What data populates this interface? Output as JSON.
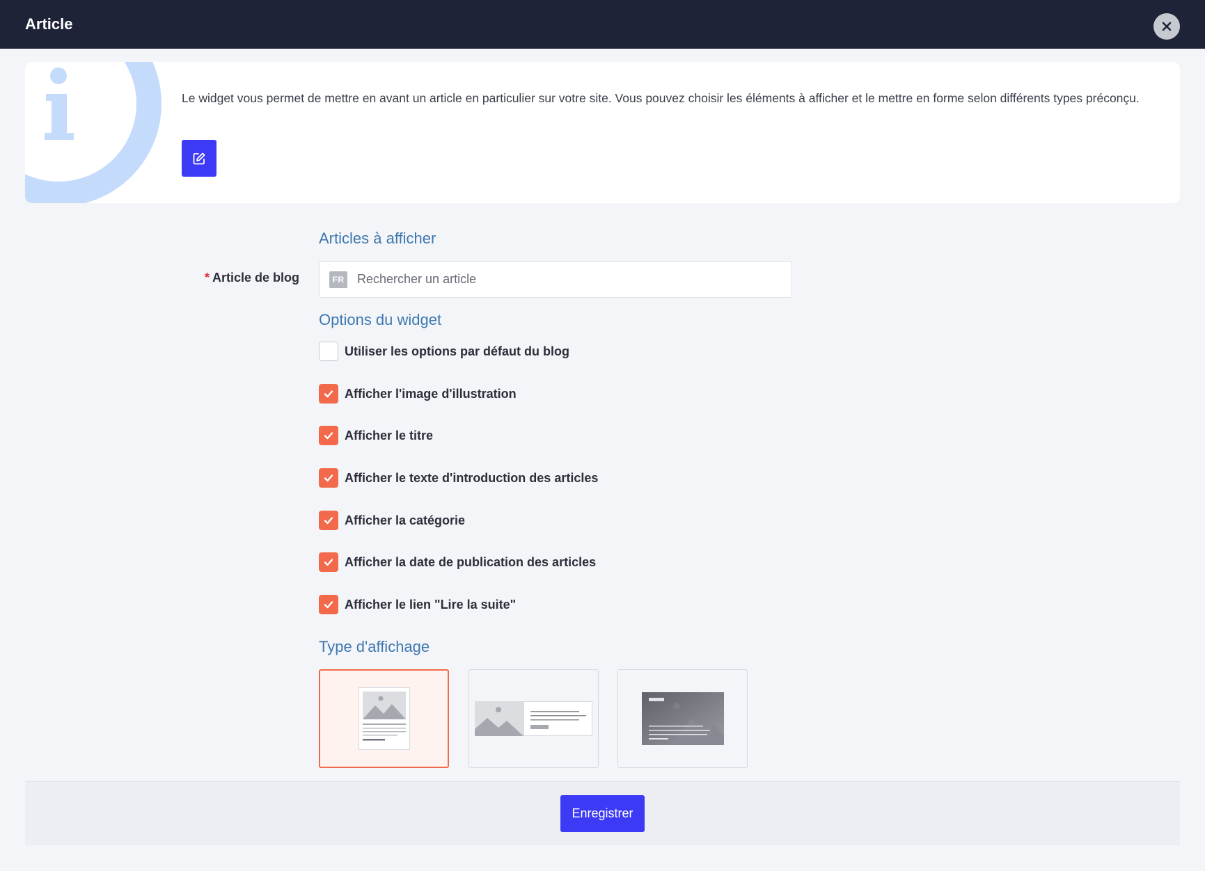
{
  "header": {
    "title": "Article"
  },
  "info": {
    "description": "Le widget vous permet de mettre en avant un article en particulier sur votre site. Vous pouvez choisir les éléments à afficher et le mettre en forme selon différents types préconçu."
  },
  "sections": {
    "articles": "Articles à afficher",
    "options": "Options du widget",
    "display_type": "Type d'affichage"
  },
  "blog_field": {
    "required_mark": "*",
    "label": "Article de blog",
    "lang": "FR",
    "placeholder": "Rechercher un article"
  },
  "options": [
    {
      "label": "Utiliser les options par défaut du blog",
      "checked": false
    },
    {
      "label": "Afficher l'image d'illustration",
      "checked": true
    },
    {
      "label": "Afficher le titre",
      "checked": true
    },
    {
      "label": "Afficher le texte d'introduction des articles",
      "checked": true
    },
    {
      "label": "Afficher la catégorie",
      "checked": true
    },
    {
      "label": "Afficher la date de publication des articles",
      "checked": true
    },
    {
      "label": "Afficher le lien \"Lire la suite\"",
      "checked": true
    }
  ],
  "display_types": [
    {
      "layout": "vertical-card",
      "selected": true
    },
    {
      "layout": "horizontal-card",
      "selected": false
    },
    {
      "layout": "overlay-card",
      "selected": false
    }
  ],
  "footer": {
    "save_label": "Enregistrer"
  },
  "icons": {
    "close": "close-icon",
    "info": "info-icon",
    "edit": "edit-icon",
    "check": "check-icon"
  },
  "colors": {
    "header_bg": "#1f2338",
    "primary": "#3d3af5",
    "accent": "#f26a4b",
    "section_title": "#3d78b0",
    "required": "#e02b3b"
  }
}
